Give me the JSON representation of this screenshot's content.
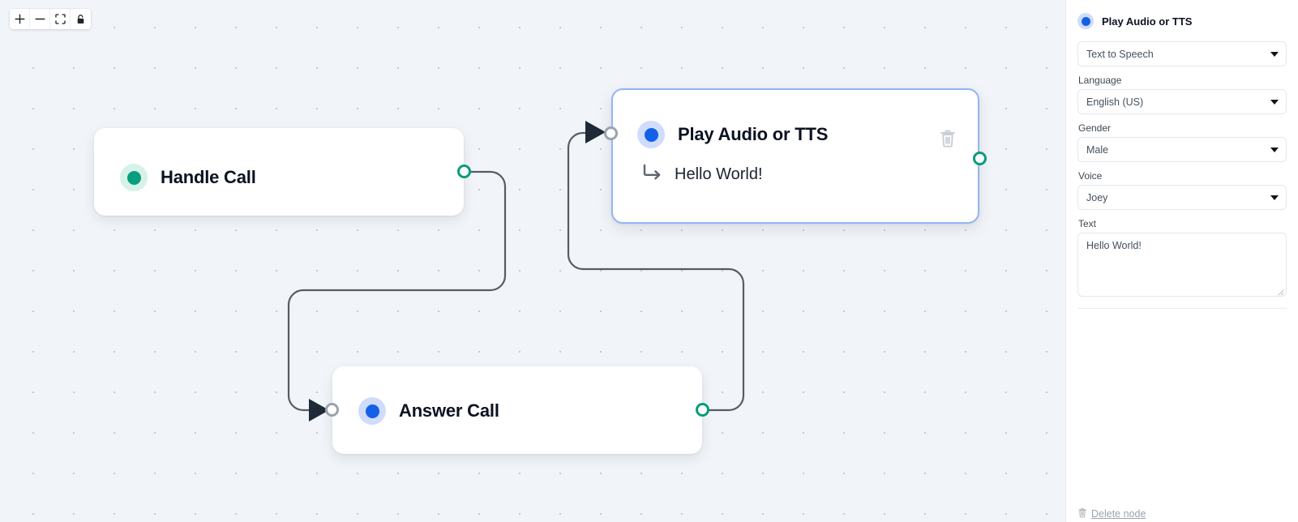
{
  "toolbar": {
    "buttons": [
      {
        "name": "zoom-in",
        "label": "+"
      },
      {
        "name": "zoom-out",
        "label": "−"
      },
      {
        "name": "fit-view",
        "label": ""
      },
      {
        "name": "lock",
        "label": ""
      }
    ]
  },
  "canvas": {
    "nodes": [
      {
        "id": "handle-call",
        "title": "Handle Call",
        "dot_color": "#089e7e",
        "dot_halo": "#d6f2e9",
        "selected": false,
        "subtitle": null,
        "has_target_handle": false,
        "has_source_handle": true
      },
      {
        "id": "play-audio-or-tts",
        "title": "Play Audio or TTS",
        "dot_color": "#1461e8",
        "dot_halo": "#cfdcfb",
        "selected": true,
        "subtitle": "Hello World!",
        "has_target_handle": true,
        "has_source_handle": true
      },
      {
        "id": "answer-call",
        "title": "Answer Call",
        "dot_color": "#1461e8",
        "dot_halo": "#cfdcfb",
        "selected": false,
        "subtitle": null,
        "has_target_handle": true,
        "has_source_handle": true
      }
    ],
    "edges": [
      {
        "from": "handle-call",
        "to": "answer-call"
      },
      {
        "from": "answer-call",
        "to": "play-audio-or-tts"
      }
    ]
  },
  "panel": {
    "title": "Play Audio or TTS",
    "node_type": {
      "value": "Text to Speech"
    },
    "fields": [
      {
        "label": "Language",
        "value": "English (US)"
      },
      {
        "label": "Gender",
        "value": "Male"
      },
      {
        "label": "Voice",
        "value": "Joey"
      }
    ],
    "text_field": {
      "label": "Text",
      "value": "Hello World!"
    },
    "delete_label": "Delete node"
  },
  "colors": {
    "accent_blue": "#1461e8",
    "accent_green": "#089e7e",
    "selection_border": "#93b4f4",
    "canvas_bg": "#f1f5f9",
    "edge_stroke": "#555c66"
  }
}
